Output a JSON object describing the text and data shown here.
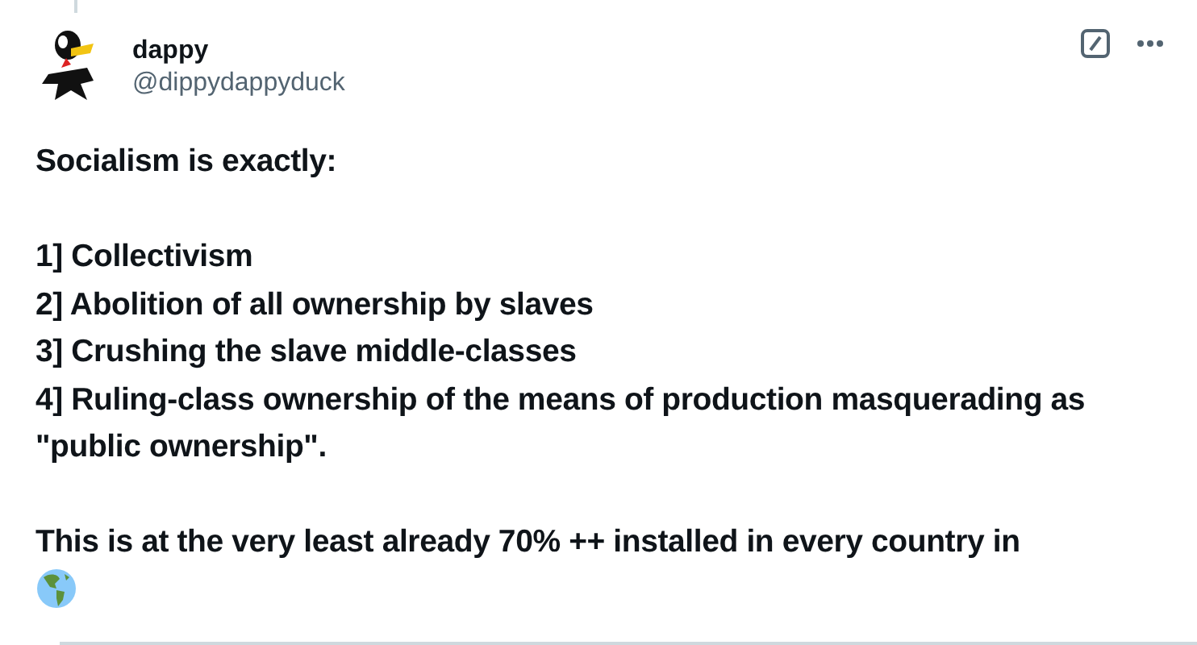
{
  "author": {
    "name": "dappy",
    "handle": "@dippydappyduck"
  },
  "paragraphs": [
    {
      "lines": [
        "Socialism is exactly:"
      ]
    },
    {
      "lines": [
        "1] Collectivism",
        "2] Abolition of all ownership by slaves",
        "3] Crushing the slave middle-classes",
        "4] Ruling-class ownership of the means of production masquerading as \"public ownership\"."
      ]
    },
    {
      "lines": [
        "This is at the very least already 70% ++ installed in every country in"
      ]
    }
  ]
}
